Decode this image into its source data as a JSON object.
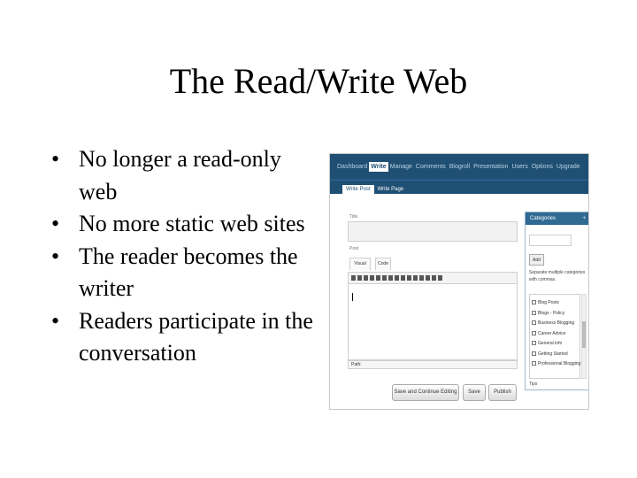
{
  "slide": {
    "title": "The Read/Write Web",
    "bullets": [
      "No longer a read-only web",
      "No more static web sites",
      "The reader becomes the writer",
      "Readers participate in the conversation"
    ]
  },
  "screenshot": {
    "nav_tabs": [
      "Dashboard",
      "Write",
      "Manage",
      "Comments",
      "Blogroll",
      "Presentation",
      "Users",
      "Options",
      "Upgrade"
    ],
    "active_nav": "Write",
    "subnav_tabs": [
      "Write Post",
      "Write Page"
    ],
    "title_label": "Title",
    "post_label": "Post",
    "mode_tabs": [
      "Visual",
      "Code"
    ],
    "path_label": "Path:",
    "buttons": [
      "Save and Continue Editing",
      "Save",
      "Publish"
    ],
    "categories": {
      "header": "Categories",
      "toggle": "+",
      "add_button": "Add",
      "note": "Separate multiple categories with commas.",
      "items": [
        "Blog Posts",
        "Blogs - Policy",
        "Business Blogging",
        "Career Advice",
        "General info",
        "Getting Started",
        "Professional Blogging"
      ],
      "footer": "Tips"
    },
    "colors": {
      "nav": "#1f4f73",
      "category_header": "#2f6a93"
    }
  }
}
